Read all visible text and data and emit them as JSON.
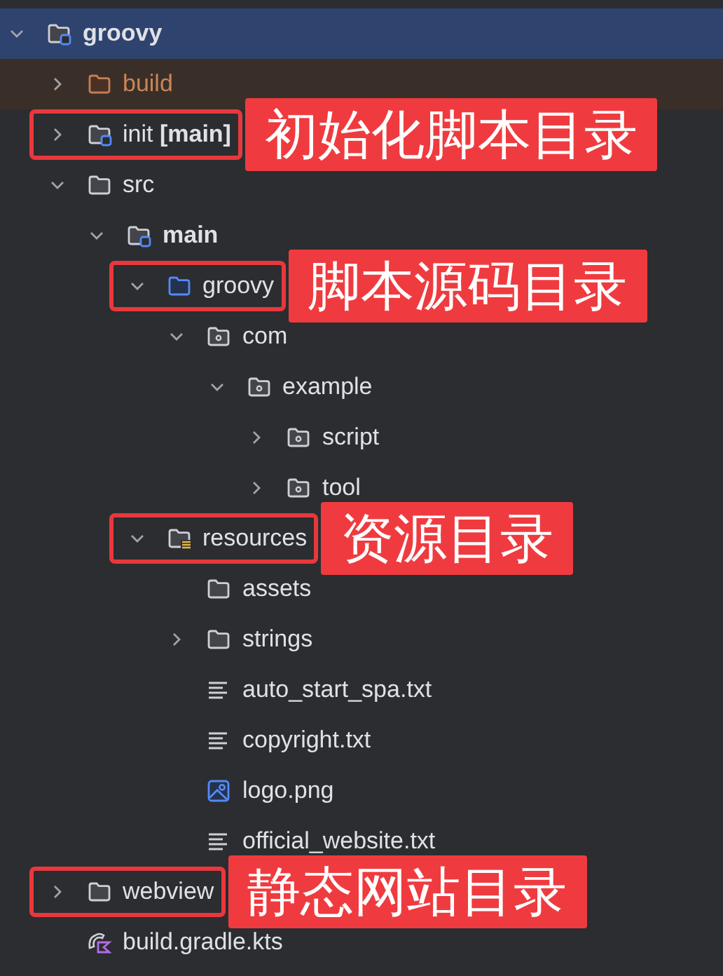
{
  "tree": [
    {
      "label": "groovy",
      "kind": "module",
      "bold": true,
      "selected": true,
      "expanded": true,
      "children": [
        {
          "label": "build",
          "kind": "excluded",
          "selected": false,
          "expanded": false
        },
        {
          "label": "init **[main]**",
          "kind": "module",
          "selected": false,
          "expanded": false,
          "callout": "初始化脚本目录"
        },
        {
          "label": "src",
          "kind": "folder",
          "selected": false,
          "expanded": true,
          "children": [
            {
              "label": "main",
              "kind": "module",
              "bold": true,
              "selected": false,
              "expanded": true,
              "children": [
                {
                  "label": "groovy",
                  "kind": "source",
                  "selected": false,
                  "expanded": true,
                  "callout": "脚本源码目录",
                  "children": [
                    {
                      "label": "com",
                      "kind": "package",
                      "selected": false,
                      "expanded": true,
                      "children": [
                        {
                          "label": "example",
                          "kind": "package",
                          "selected": false,
                          "expanded": true,
                          "children": [
                            {
                              "label": "script",
                              "kind": "package",
                              "selected": false,
                              "expanded": false
                            },
                            {
                              "label": "tool",
                              "kind": "package",
                              "selected": false,
                              "expanded": false
                            }
                          ]
                        }
                      ]
                    }
                  ]
                },
                {
                  "label": "resources",
                  "kind": "resources",
                  "selected": false,
                  "expanded": true,
                  "callout": "资源目录",
                  "children": [
                    {
                      "label": "assets",
                      "kind": "folder",
                      "selected": false
                    },
                    {
                      "label": "strings",
                      "kind": "folder",
                      "selected": false,
                      "expanded": false
                    },
                    {
                      "label": "auto_start_spa.txt",
                      "kind": "text",
                      "selected": false
                    },
                    {
                      "label": "copyright.txt",
                      "kind": "text",
                      "selected": false
                    },
                    {
                      "label": "logo.png",
                      "kind": "image",
                      "selected": false
                    },
                    {
                      "label": "official_website.txt",
                      "kind": "text",
                      "selected": false
                    }
                  ]
                }
              ]
            }
          ]
        },
        {
          "label": "webview",
          "kind": "folder",
          "selected": false,
          "expanded": false,
          "callout": "静态网站目录"
        },
        {
          "label": "build.gradle.kts",
          "kind": "gradle",
          "selected": false
        }
      ]
    }
  ]
}
